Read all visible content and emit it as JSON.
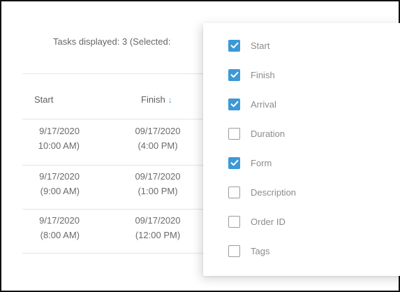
{
  "tasks_displayed": "Tasks displayed: 3 (Selected:",
  "columns": {
    "start": "Start",
    "finish": "Finish"
  },
  "sort_icon": "arrow-down-icon",
  "rows": [
    {
      "start_date": "9/17/2020",
      "start_time": "10:00 AM)",
      "finish_date": "09/17/2020",
      "finish_time": "(4:00 PM)"
    },
    {
      "start_date": "9/17/2020",
      "start_time": "(9:00 AM)",
      "finish_date": "09/17/2020",
      "finish_time": "(1:00 PM)"
    },
    {
      "start_date": "9/17/2020",
      "start_time": "(8:00 AM)",
      "finish_date": "09/17/2020",
      "finish_time": "(12:00 PM)"
    }
  ],
  "column_options": [
    {
      "label": "Start",
      "checked": true
    },
    {
      "label": "Finish",
      "checked": true
    },
    {
      "label": "Arrival",
      "checked": true
    },
    {
      "label": "Duration",
      "checked": false
    },
    {
      "label": "Form",
      "checked": true
    },
    {
      "label": "Description",
      "checked": false
    },
    {
      "label": "Order ID",
      "checked": false
    },
    {
      "label": "Tags",
      "checked": false
    }
  ],
  "colors": {
    "accent": "#3d99d6",
    "sort_arrow": "#3aa0d8"
  }
}
